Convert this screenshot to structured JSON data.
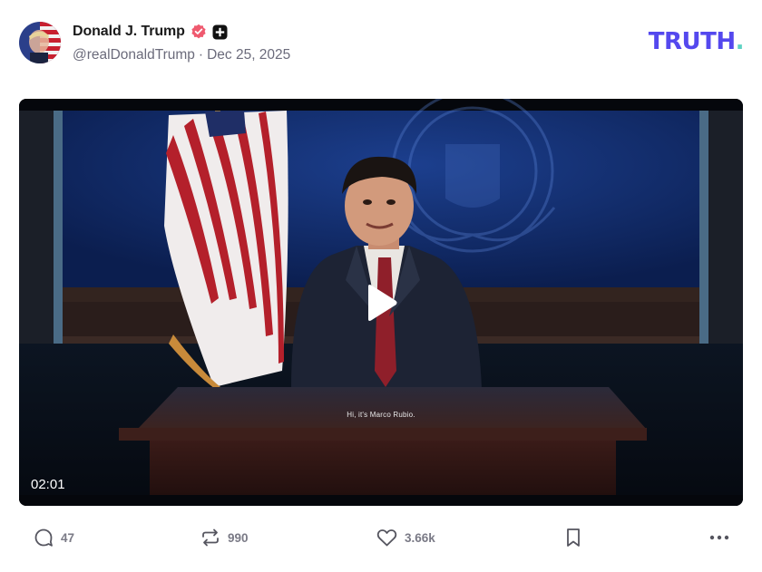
{
  "author": {
    "display_name": "Donald J. Trump",
    "handle": "@realDonaldTrump",
    "separator": "·",
    "date": "Dec 25, 2025",
    "verified_icon": "verified-badge-icon",
    "extra_badge_icon": "plus-square-icon"
  },
  "brand": {
    "logo_text": "TRUTH",
    "logo_dot": ".",
    "logo_color": "#5448ee",
    "dot_color": "#5fd3c3"
  },
  "video": {
    "caption": "Hi, it's Marco Rubio.",
    "duration": "02:01",
    "play_icon": "play-icon"
  },
  "actions": {
    "replies": {
      "icon": "comment-icon",
      "count": "47"
    },
    "retruths": {
      "icon": "retruth-icon",
      "count": "990"
    },
    "likes": {
      "icon": "heart-icon",
      "count": "3.66k"
    },
    "bookmark": {
      "icon": "bookmark-icon"
    },
    "more": {
      "icon": "more-dots-icon"
    }
  }
}
